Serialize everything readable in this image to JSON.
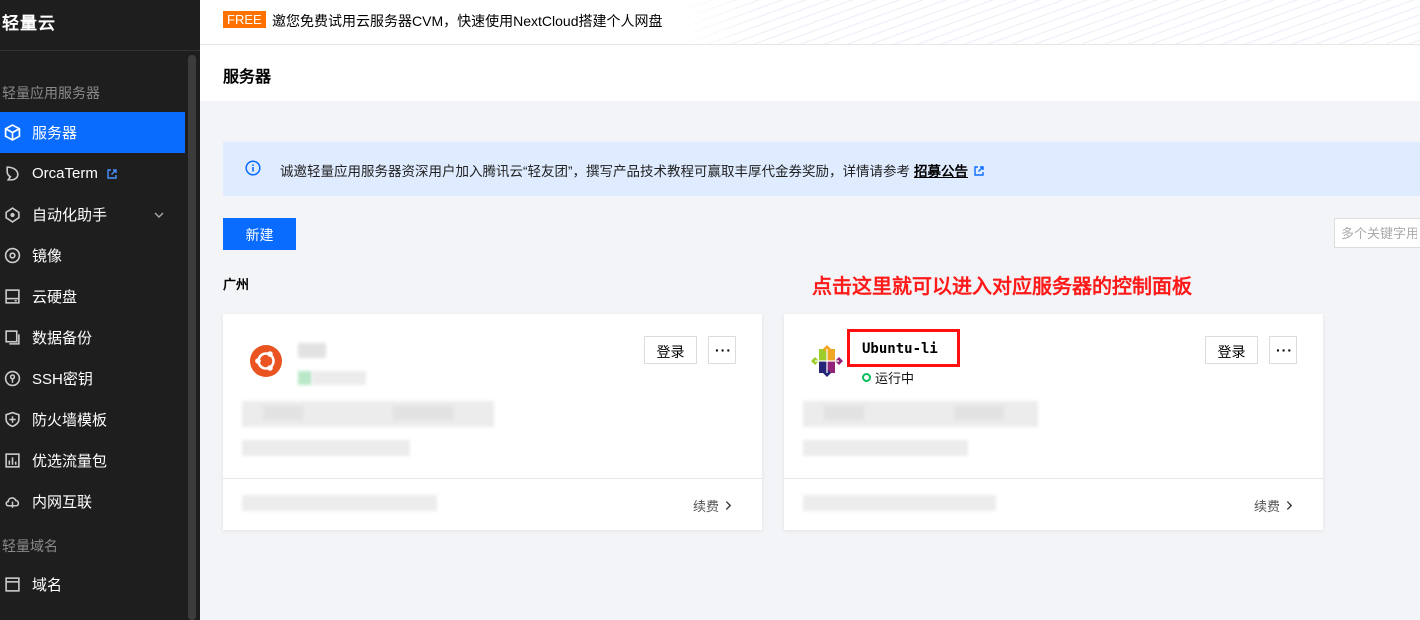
{
  "sidebar": {
    "brand": "轻量云",
    "section_servers": "轻量应用服务器",
    "items": [
      {
        "label": "服务器",
        "icon": "cube-icon",
        "active": true
      },
      {
        "label": "OrcaTerm",
        "icon": "orca-icon",
        "external": true
      },
      {
        "label": "自动化助手",
        "icon": "robot-icon",
        "expandable": true
      },
      {
        "label": "镜像",
        "icon": "disc-icon"
      },
      {
        "label": "云硬盘",
        "icon": "harddisk-icon"
      },
      {
        "label": "数据备份",
        "icon": "backup-icon"
      },
      {
        "label": "SSH密钥",
        "icon": "key-icon"
      },
      {
        "label": "防火墙模板",
        "icon": "shield-icon"
      },
      {
        "label": "优选流量包",
        "icon": "traffic-icon"
      },
      {
        "label": "内网互联",
        "icon": "network-icon"
      }
    ],
    "section_domains": "轻量域名",
    "domain_items": [
      {
        "label": "域名",
        "icon": "domain-icon"
      }
    ]
  },
  "banner": {
    "tag": "FREE",
    "text": "邀您免费试用云服务器CVM，快速使用NextCloud搭建个人网盘"
  },
  "page": {
    "title": "服务器"
  },
  "alert": {
    "text": "诚邀轻量应用服务器资深用户加入腾讯云“轻友团”，撰写产品技术教程可赢取丰厚代金券奖励，详情请参考",
    "link": "招募公告"
  },
  "toolbar": {
    "new_label": "新建",
    "search_placeholder": "多个关键字用"
  },
  "region": "广州",
  "annotation": "点击这里就可以进入对应服务器的控制面板",
  "cards": [
    {
      "name": "",
      "os_icon": "ubuntu-icon",
      "status": "",
      "login_label": "登录",
      "more_label": "···",
      "renew_label": "续费"
    },
    {
      "name": "Ubuntu-li",
      "os_icon": "centos-icon",
      "status": "运行中",
      "login_label": "登录",
      "more_label": "···",
      "renew_label": "续费"
    }
  ],
  "colors": {
    "accent": "#0a6cff",
    "sidebar_bg": "#1e1e1e",
    "free_tag": "#ff7200",
    "annotation": "#ff1a1a",
    "status_running": "#0abf5b"
  }
}
